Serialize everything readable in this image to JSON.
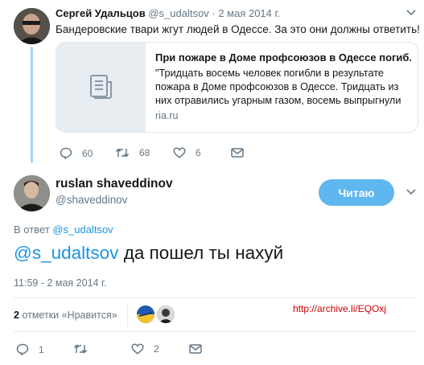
{
  "parent": {
    "display_name": "Сергей Удальцов",
    "handle": "@s_udaltsov",
    "separator": "·",
    "date": "2 мая 2014 г.",
    "text": "Бандеровские твари жгут людей в Одессе. За это они должны ответить!",
    "card": {
      "title": "При пожаре в Доме профсоюзов в Одессе погиб...",
      "description": "\"Тридцать восемь человек погибли в результате пожара в Доме профсоюзов в Одессе. Тридцать из них отравились угарным газом, восемь выпрыгнули",
      "domain": "ria.ru",
      "thumbnail_icon": "document-icon"
    },
    "actions": {
      "reply_count": "60",
      "retweet_count": "68",
      "like_count": "6"
    }
  },
  "reply": {
    "display_name": "ruslan shaveddinov",
    "handle": "@shaveddinov",
    "follow_label": "Читаю",
    "reply_to_prefix": "В ответ",
    "reply_to_handle": "@s_udaltsov",
    "mention": "@s_udaltsov",
    "text": "да пошел ты нахуй",
    "timestamp": "11:59 - 2 мая 2014 г.",
    "likes_count": "2",
    "likes_label": "отметки «Нравится»",
    "actions": {
      "reply_count": "1",
      "retweet_count": "",
      "like_count": "2"
    }
  },
  "archive_link": "http://archive.li/EQOxj",
  "colors": {
    "accent": "#1b95e0",
    "follow_button": "#60b6ee",
    "thread_line": "#a5d6f5",
    "archive_link": "#cc0000"
  }
}
